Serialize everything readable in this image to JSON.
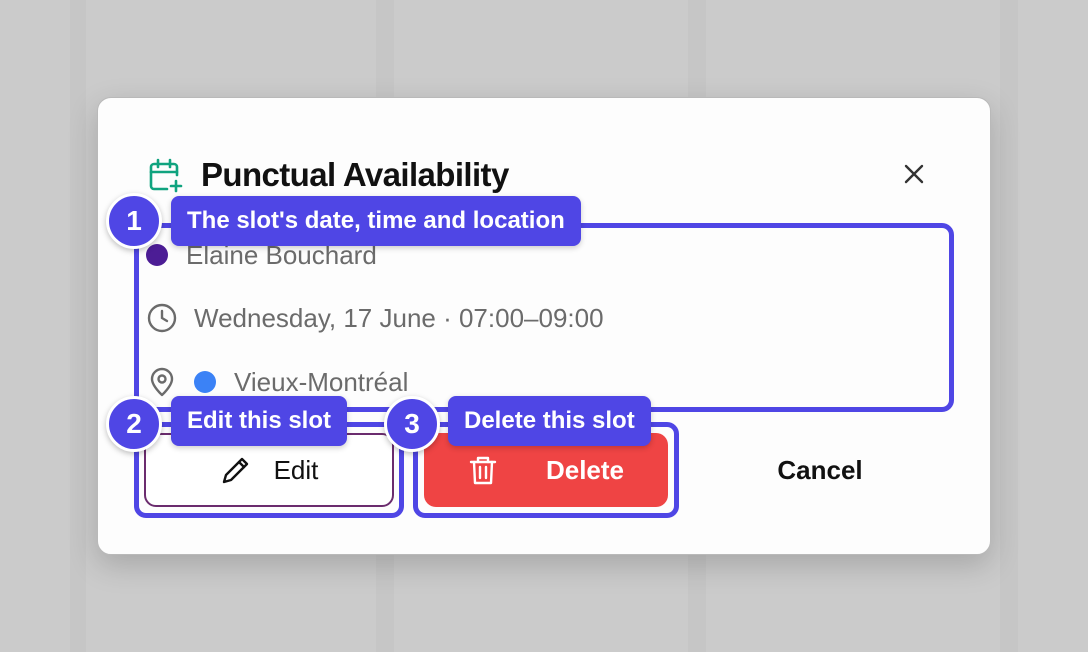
{
  "modal": {
    "title": "Punctual Availability",
    "person_name": "Elaine Bouchard",
    "person_color": "#4c1d95",
    "datetime": "Wednesday, 17 June · 07:00–09:00",
    "location": "Vieux-Montréal",
    "location_color": "#3b82f6",
    "icons": {
      "title": "calendar-plus-icon",
      "close": "close-icon",
      "time": "clock-icon",
      "location": "map-pin-icon",
      "edit": "pencil-icon",
      "delete": "trash-icon"
    }
  },
  "buttons": {
    "edit_label": "Edit",
    "delete_label": "Delete",
    "cancel_label": "Cancel"
  },
  "annotations": [
    {
      "number": "1",
      "text": "The slot's date, time and location"
    },
    {
      "number": "2",
      "text": "Edit this slot"
    },
    {
      "number": "3",
      "text": "Delete this slot"
    }
  ],
  "colors": {
    "accent": "#4f46e5",
    "danger": "#ef4444",
    "calendar_icon": "#10a37f"
  }
}
